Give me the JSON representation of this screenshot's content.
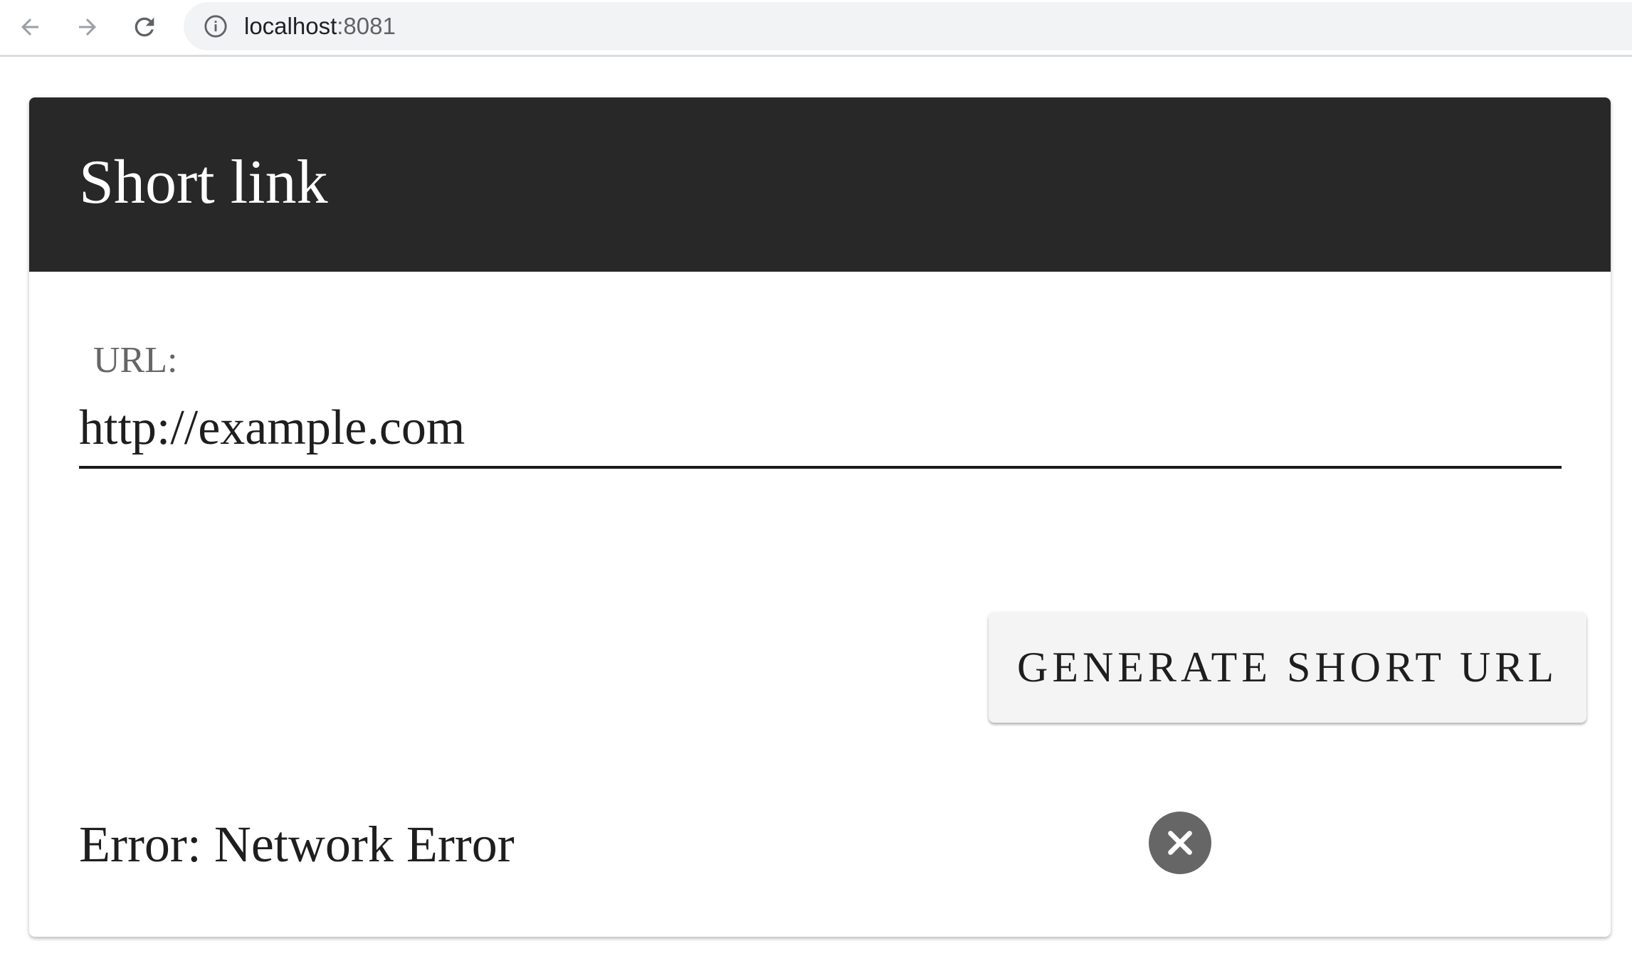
{
  "browser": {
    "url_host": "localhost",
    "url_port": ":8081",
    "icons": {
      "back": "arrow-left-icon",
      "forward": "arrow-right-icon",
      "reload": "reload-icon",
      "site_info": "info-icon"
    }
  },
  "card": {
    "title": "Short link",
    "url_label": "URL:",
    "url_value": "http://example.com",
    "generate_label": "GENERATE SHORT URL",
    "error_message": "Error: Network Error",
    "close_icon": "close-circle-icon"
  },
  "colors": {
    "header_bg": "#282828",
    "header_text": "#ffffff",
    "button_bg": "#f4f4f4",
    "close_bg": "#666666"
  }
}
